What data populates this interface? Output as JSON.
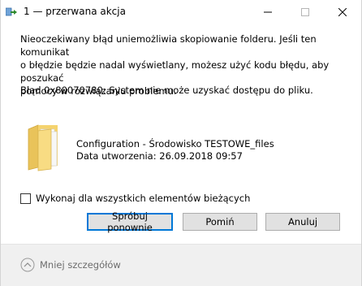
{
  "window": {
    "title": "1 — przerwana akcja",
    "buttons": {
      "minimize": "minimize-icon",
      "maximize": "maximize-icon",
      "close": "close-icon"
    }
  },
  "message": {
    "line1": "Nieoczekiwany błąd uniemożliwia skopiowanie folderu. Jeśli ten komunikat",
    "line2": "o błędzie będzie nadal wyświetlany, możesz użyć kodu błędu, aby poszukać",
    "line3": "pomocy w rozwiązaniu problemu.",
    "error": "Błąd 0x80070780: System nie może uzyskać dostępu do pliku."
  },
  "file": {
    "name": "Configuration - Środowisko TESTOWE_files",
    "date": "Data utworzenia: 26.09.2018 09:57"
  },
  "checkbox": {
    "label": "Wykonaj dla wszystkich elementów bieżących",
    "checked": false
  },
  "actions": {
    "retry": "Spróbuj ponownie",
    "skip": "Pomiń",
    "cancel": "Anuluj"
  },
  "footer": {
    "details_label": "Mniej szczegółów"
  },
  "colors": {
    "accent": "#0078d7",
    "footer_bg": "#f0f0f0",
    "button_bg": "#e1e1e1",
    "folder": "#f5d36e"
  }
}
